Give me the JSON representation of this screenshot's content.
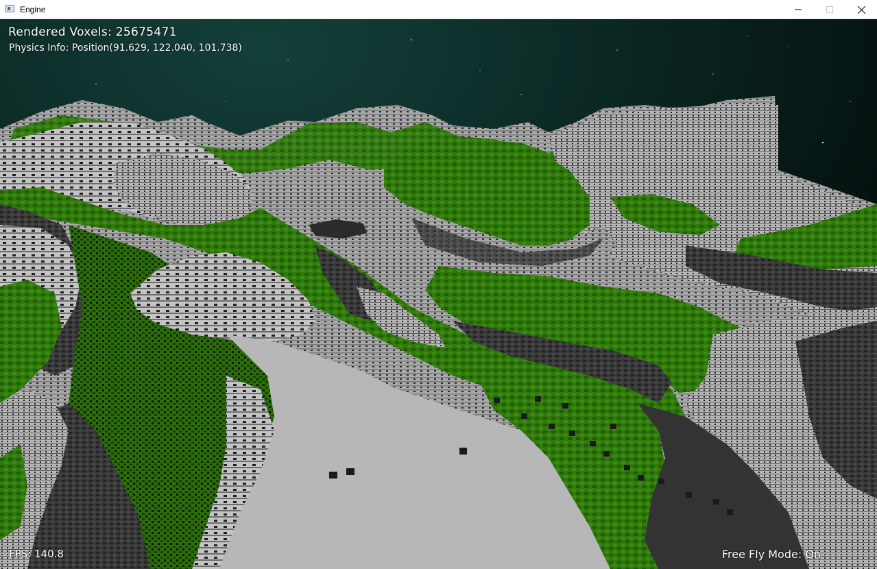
{
  "window": {
    "title": "Engine",
    "icon": "app-window-icon",
    "controls": [
      "minimize-icon",
      "maximize-icon",
      "close-icon"
    ]
  },
  "hud": {
    "rendered_voxels": "Rendered Voxels: 25675471",
    "physics_info": "Physics Info: Position(91.629, 122.040, 101.738)",
    "fps": "FPS: 140.8",
    "mode": "Free Fly Mode: On"
  },
  "scene": {
    "description_colors": {
      "grass": "#2e7a0a",
      "rock_light": "#a8a8a8",
      "rock_dark": "#3a3a3a",
      "sky": "#0c2a26"
    }
  }
}
